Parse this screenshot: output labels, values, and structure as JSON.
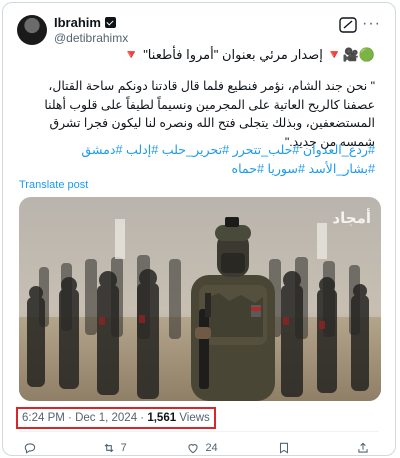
{
  "author": {
    "name": "Ibrahim",
    "handle": "@detibrahimx",
    "avatar": "avatar",
    "verified_icon": "verified-badge-icon"
  },
  "header_icons": {
    "grok": "grok-icon",
    "more": "···"
  },
  "post": {
    "title_line": "🟢🎥🔻 إصدار مرئي بعنوان \"أمروا فأطعنا\" 🔻",
    "body": "\" نحن جند الشام، نؤمر فنطيع فلما قال قادتنا دونكم ساحة القتال، عصفنا كالريح العاتية على المجرمين ونسيماً لطيفاً على قلوب أهلنا المستضعفين، وبذلك يتجلى فتح الله ونصره لنا ليكون فجرا تشرق شمسه من جديد.\"",
    "hashtags": "#ردع_العدوان #حلب_تتحرر #تحرير_حلب #إدلب #دمشق #بشار_الأسد #سوريا #حماه",
    "translate_label": "Translate post"
  },
  "media": {
    "watermark": "أمجاد",
    "alt": "video still of soldiers"
  },
  "meta": {
    "time": "6:24 PM",
    "sep1": "·",
    "date": "Dec 1, 2024",
    "sep2": "·",
    "views_count": "1,561",
    "views_label": "Views"
  },
  "actions": {
    "reply": "",
    "retweet": "7",
    "like": "24",
    "bookmark": "",
    "share": ""
  },
  "colors": {
    "link": "#1d9bf0",
    "secondary": "#536471",
    "highlight_box": "#d9262b"
  }
}
